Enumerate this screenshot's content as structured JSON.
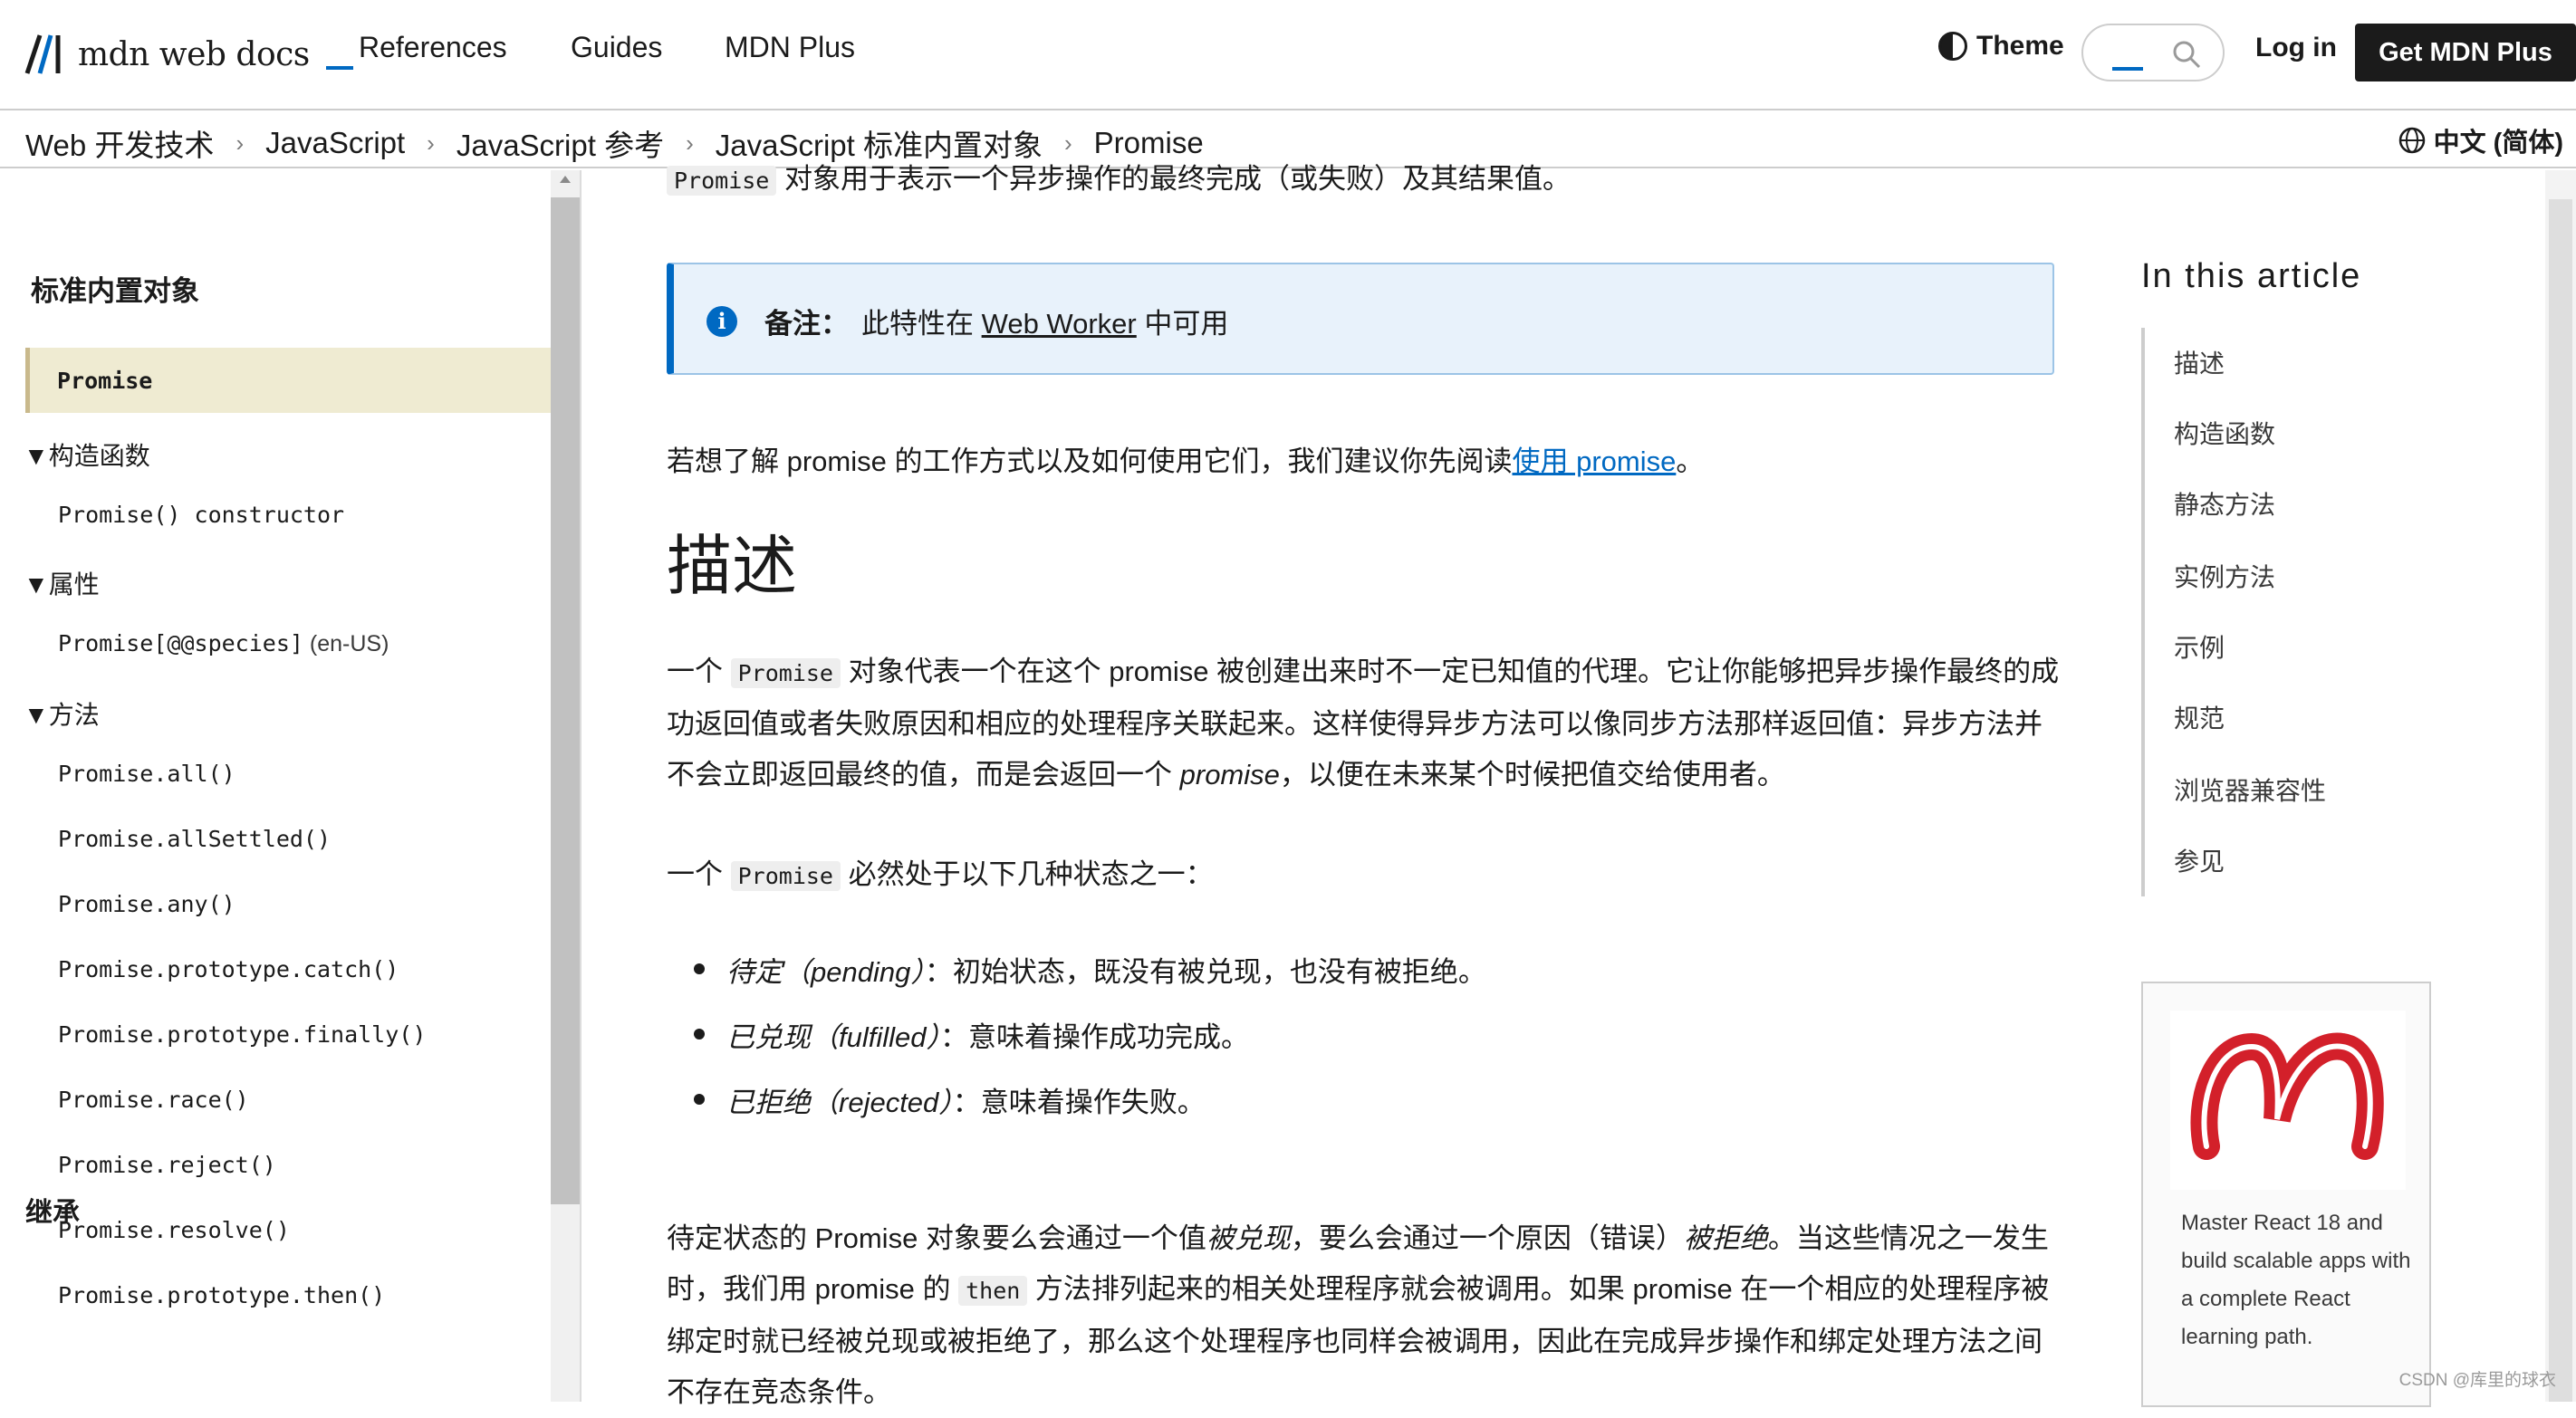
{
  "nav": {
    "logo_text": "mdn web docs",
    "links": [
      "References",
      "Guides",
      "MDN Plus"
    ],
    "theme_label": "Theme",
    "search_placeholder": "",
    "login_label": "Log in",
    "get_plus_label": "Get MDN Plus"
  },
  "breadcrumb": {
    "items": [
      "Web 开发技术",
      "JavaScript",
      "JavaScript 参考",
      "JavaScript 标准内置对象",
      "Promise"
    ],
    "separator": "›"
  },
  "language": {
    "label": "中文 (简体)"
  },
  "sidebar": {
    "heading": "标准内置对象",
    "current": "Promise",
    "groups": [
      {
        "label": "▼构造函数",
        "items": [
          {
            "text": "Promise() constructor",
            "note": ""
          }
        ]
      },
      {
        "label": "▼属性",
        "items": [
          {
            "text": "Promise[@@species]",
            "note": " (en-US)"
          }
        ]
      },
      {
        "label": "▼方法",
        "items": [
          {
            "text": "Promise.all()",
            "note": ""
          },
          {
            "text": "Promise.allSettled()",
            "note": ""
          },
          {
            "text": "Promise.any()",
            "note": ""
          },
          {
            "text": "Promise.prototype.catch()",
            "note": ""
          },
          {
            "text": "Promise.prototype.finally()",
            "note": ""
          },
          {
            "text": "Promise.race()",
            "note": ""
          },
          {
            "text": "Promise.reject()",
            "note": ""
          },
          {
            "text": "Promise.resolve()",
            "note": ""
          },
          {
            "text": "Promise.prototype.then()",
            "note": ""
          }
        ]
      }
    ],
    "inherit_heading": "继承"
  },
  "content": {
    "intro_code": "Promise",
    "intro_text": " 对象用于表示一个异步操作的最终完成（或失败）及其结果值。",
    "note_label": "备注：",
    "note_pre": "此特性在 ",
    "note_link": "Web Worker",
    "note_post": " 中可用",
    "learn_pre": "若想了解 promise 的工作方式以及如何使用它们，我们建议你先阅读",
    "learn_link": "使用 promise",
    "learn_post": "。",
    "desc_heading": "描述",
    "p1_a": "一个 ",
    "p1_code": "Promise",
    "p1_b": " 对象代表一个在这个 promise 被创建出来时不一定已知值的代理。它让你能够把异步操作最终的成功返回值或者失败原因和相应的处理程序关联起来。这样使得异步方法可以像同步方法那样返回值：异步方法并不会立即返回最终的值，而是会返回一个 ",
    "p1_em": "promise",
    "p1_c": "，以便在未来某个时候把值交给使用者。",
    "p2_a": "一个 ",
    "p2_code": "Promise",
    "p2_b": " 必然处于以下几种状态之一：",
    "states": [
      {
        "name": "待定（pending）",
        "desc": "：初始状态，既没有被兑现，也没有被拒绝。"
      },
      {
        "name": "已兑现（fulfilled）",
        "desc": "：意味着操作成功完成。"
      },
      {
        "name": "已拒绝（rejected）",
        "desc": "：意味着操作失败。"
      }
    ],
    "p3_a": "待定状态的 Promise 对象要么会通过一个值",
    "p3_em1": "被兑现",
    "p3_b": "，要么会通过一个原因（错误）",
    "p3_em2": "被拒绝",
    "p3_c": "。当这些情况之一发生时，我们用 promise 的 ",
    "p3_code": "then",
    "p3_d": " 方法排列起来的相关处理程序就会被调用。如果 promise 在一个相应的处理程序被绑定时就已经被兑现或被拒绝了，那么这个处理程序也同样会被调用，因此在完成异步操作和绑定处理方法之间不存在竞态条件。"
  },
  "toc": {
    "title": "In this article",
    "items": [
      "描述",
      "构造函数",
      "静态方法",
      "实例方法",
      "示例",
      "规范",
      "浏览器兼容性",
      "参见"
    ]
  },
  "ad": {
    "text": "Master React 18 and build scalable apps with a complete React learning path."
  },
  "watermark": "CSDN @库里的球衣",
  "colors": {
    "accent": "#0069c2",
    "note_bg": "#e8f2fb",
    "current_bg": "#efebd2",
    "ad_red": "#d3202a"
  }
}
